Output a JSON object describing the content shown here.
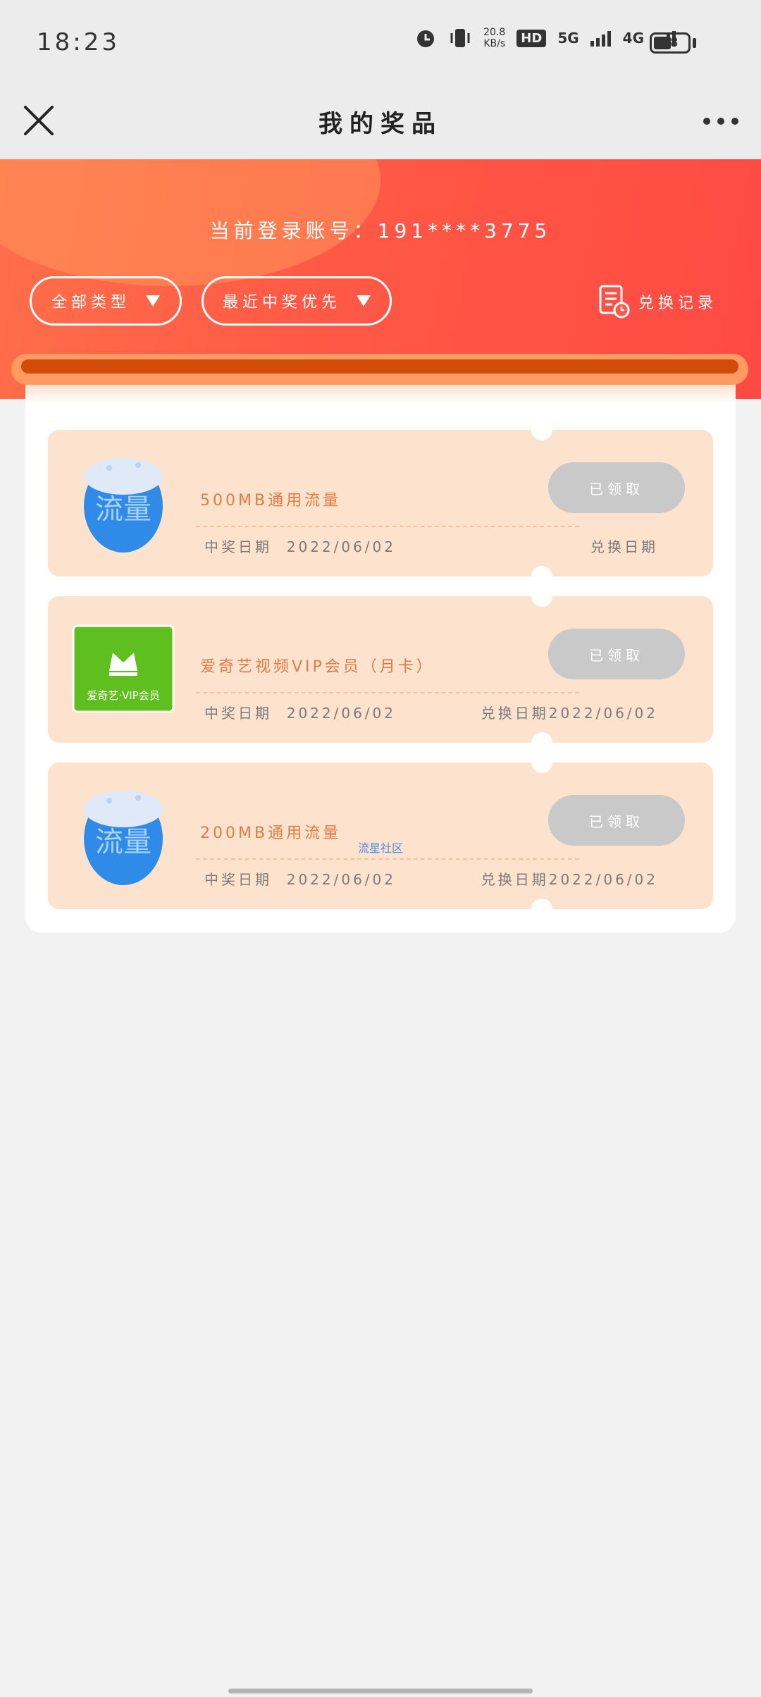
{
  "status_bar": {
    "time": "18:23",
    "net_speed_value": "20.8",
    "net_speed_unit": "KB/s",
    "hd_label": "HD",
    "hd_sub": "1 2",
    "net_5g": "5G",
    "net_4g": "4G",
    "battery": "38"
  },
  "nav": {
    "title": "我的奖品",
    "close_icon": "close-icon",
    "more_icon": "more-icon"
  },
  "header": {
    "account": "当前登录账号：191****3775",
    "filter_type": "全部类型",
    "filter_sort": "最近中奖优先",
    "record_label": "兑换记录",
    "colors": {
      "accent": "#ff4a43",
      "prize_text": "#e07b42",
      "card_bg": "#fde3ce"
    }
  },
  "prizes": [
    {
      "name": "500MB通用流量",
      "image_label": "流量",
      "win_label": "中奖日期",
      "win_date": "2022/06/02",
      "redeem_label": "兑换日期",
      "redeem_date": "",
      "status": "已领取"
    },
    {
      "name": "爱奇艺视频VIP会员（月卡）",
      "image_label": "爱奇艺·VIP会员",
      "win_label": "中奖日期",
      "win_date": "2022/06/02",
      "redeem_label": "兑换日期",
      "redeem_date": "2022/06/02",
      "status": "已领取"
    },
    {
      "name": "200MB通用流量",
      "image_label": "流量",
      "win_label": "中奖日期",
      "win_date": "2022/06/02",
      "redeem_label": "兑换日期",
      "redeem_date": "2022/06/02",
      "status": "已领取",
      "watermark": "流星社区"
    }
  ]
}
